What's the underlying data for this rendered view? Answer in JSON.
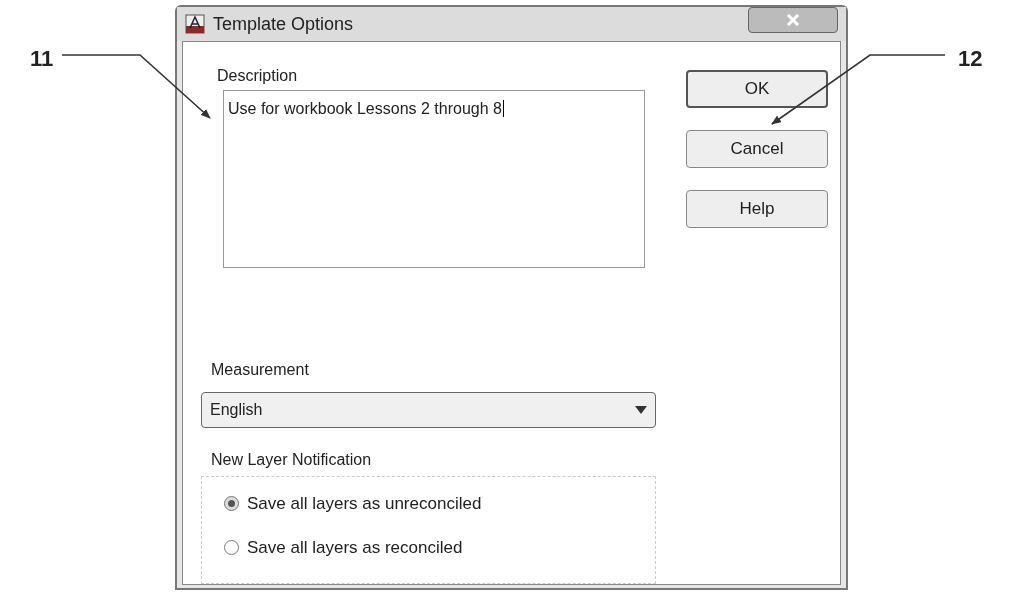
{
  "callouts": [
    {
      "label": "11",
      "kind": "left"
    },
    {
      "label": "12",
      "kind": "right"
    }
  ],
  "window": {
    "title": "Template Options"
  },
  "description": {
    "label": "Description",
    "value": "Use for workbook Lessons 2 through 8"
  },
  "buttons": [
    {
      "label": "OK",
      "default": true
    },
    {
      "label": "Cancel",
      "default": false
    },
    {
      "label": "Help",
      "default": false
    }
  ],
  "measurement": {
    "label": "Measurement",
    "value": "English"
  },
  "new_layer_notification": {
    "title": "New Layer Notification",
    "options": [
      {
        "label": "Save all layers as unreconciled",
        "selected": true
      },
      {
        "label": "Save all layers as reconciled",
        "selected": false
      }
    ]
  }
}
